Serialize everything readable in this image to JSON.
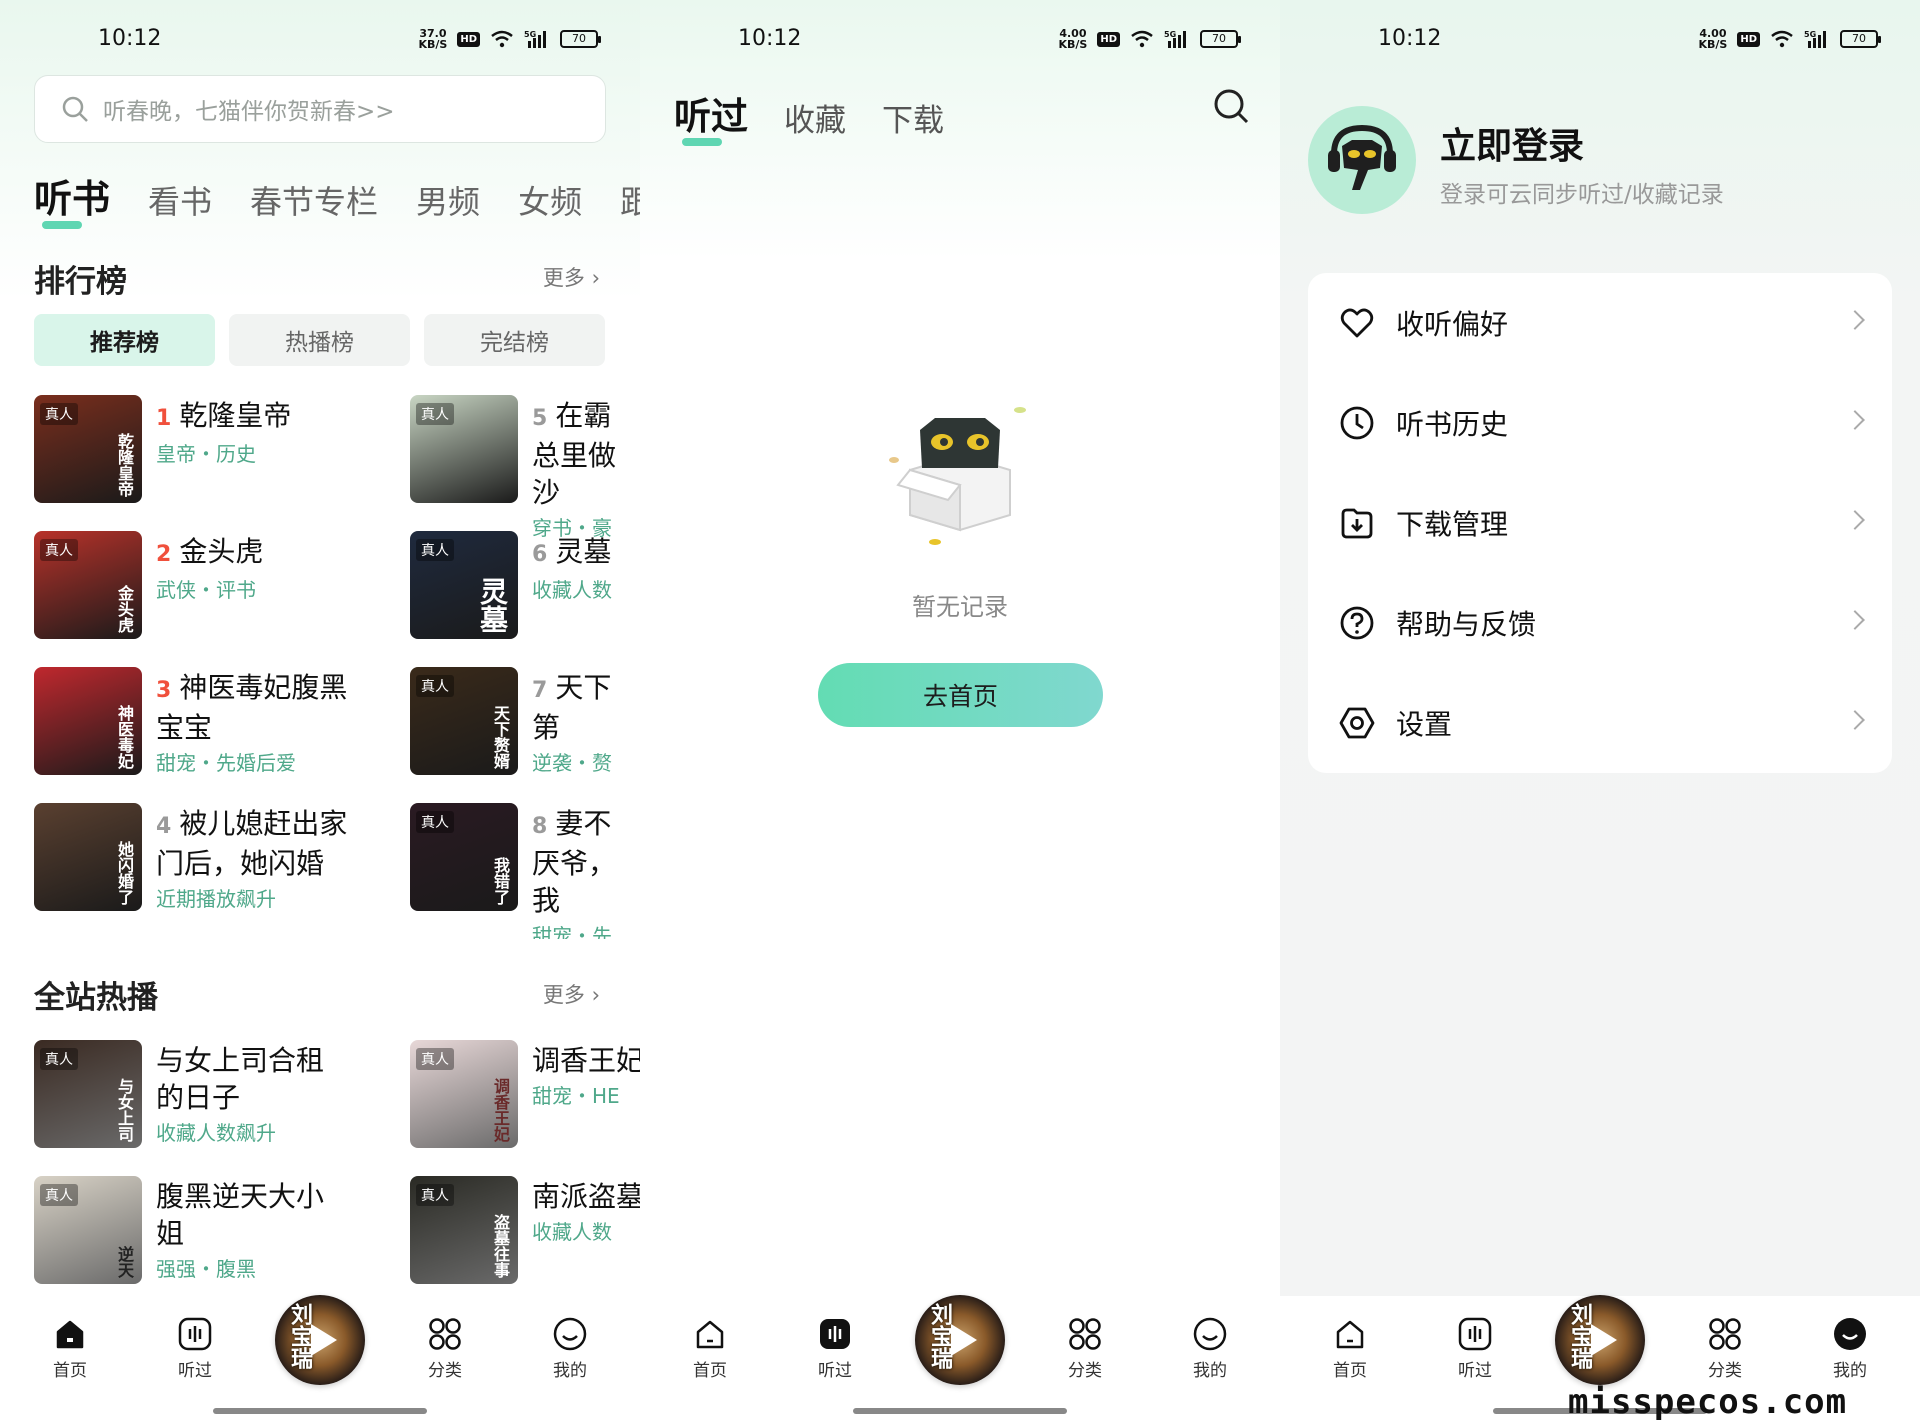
{
  "status_bar": {
    "time": "10:12",
    "left_speed_value": "37.0",
    "speed_unit": "KB/S",
    "other_speed_value": "4.00",
    "hd": "HD",
    "network": "5G",
    "battery": "70"
  },
  "home": {
    "search_placeholder": "听春晚，七猫伴你贺新春>>",
    "tabs": [
      "听书",
      "看书",
      "春节专栏",
      "男频",
      "女频",
      "跟"
    ],
    "ranking": {
      "title": "排行榜",
      "more": "更多",
      "chips": [
        "推荐榜",
        "热播榜",
        "完结榜"
      ],
      "items": [
        {
          "rank": "1",
          "title": "乾隆皇帝",
          "sub": "皇帝・历史",
          "tag": "真人",
          "cover_text": "乾隆皇帝",
          "cover_color": "#7a2e1d"
        },
        {
          "rank": "2",
          "title": "金头虎",
          "sub": "武侠・评书",
          "tag": "真人",
          "cover_text": "金头虎",
          "cover_color": "#b8322a"
        },
        {
          "rank": "3",
          "title": "神医毒妃腹黑宝宝",
          "sub": "甜宠・先婚后爱",
          "tag": "",
          "cover_text": "神医毒妃",
          "cover_color": "#c0282e"
        },
        {
          "rank": "4",
          "title": "被儿媳赶出家门后，她闪婚",
          "sub": "近期播放飙升",
          "tag": "",
          "cover_text": "她闪婚了",
          "cover_color": "#5a4030"
        },
        {
          "rank": "5",
          "title": "在霸总里做沙",
          "sub": "穿书・豪",
          "tag": "真人",
          "cover_text": "",
          "cover_color": "#c9d6c4"
        },
        {
          "rank": "6",
          "title": "灵墓",
          "sub": "收藏人数",
          "tag": "真人",
          "cover_text": "灵墓",
          "cover_color": "#1f2a3e"
        },
        {
          "rank": "7",
          "title": "天下第",
          "sub": "逆袭・赘",
          "tag": "真人",
          "cover_text": "天下赘婿",
          "cover_color": "#3a2a1a"
        },
        {
          "rank": "8",
          "title": "妻不厌爷，我",
          "sub": "甜宠・先",
          "tag": "真人",
          "cover_text": "我错了",
          "cover_color": "#2a1a22"
        }
      ]
    },
    "hot": {
      "title": "全站热播",
      "more": "更多",
      "items": [
        {
          "title": "与女上司合租的日子",
          "sub": "收藏人数飙升",
          "tag": "真人",
          "cover_text": "与女上司",
          "cover_color": "#3a2a22"
        },
        {
          "title": "腹黑逆天大小姐",
          "sub": "强强・腹黑",
          "tag": "真人",
          "cover_text": "逆天",
          "cover_color": "#d8d2c6"
        },
        {
          "title": "调香王妃",
          "sub": "甜宠・HE",
          "tag": "真人",
          "cover_text": "调香王妃",
          "cover_color": "#e8d8d8"
        },
        {
          "title": "南派盗墓",
          "sub": "收藏人数",
          "tag": "真人",
          "cover_text": "盗墓往事",
          "cover_color": "#2a2a24"
        }
      ]
    }
  },
  "listened": {
    "tabs": [
      "听过",
      "收藏",
      "下载"
    ],
    "empty_text": "暂无记录",
    "go_home": "去首页"
  },
  "mine": {
    "login_title": "立即登录",
    "login_sub": "登录可云同步听过/收藏记录",
    "menu": [
      {
        "label": "收听偏好",
        "icon": "heart-icon"
      },
      {
        "label": "听书历史",
        "icon": "clock-icon"
      },
      {
        "label": "下载管理",
        "icon": "download-icon"
      },
      {
        "label": "帮助与反馈",
        "icon": "help-icon"
      },
      {
        "label": "设置",
        "icon": "settings-icon"
      }
    ]
  },
  "bottom_nav": {
    "home": "首页",
    "listened": "听过",
    "category": "分类",
    "mine": "我的",
    "disc_text": "刘宝瑞"
  },
  "watermark": "misspecos.com",
  "colors": {
    "accent": "#5fd6b2",
    "tag_green": "#4fa88a",
    "rank_red": "#f0503c"
  }
}
